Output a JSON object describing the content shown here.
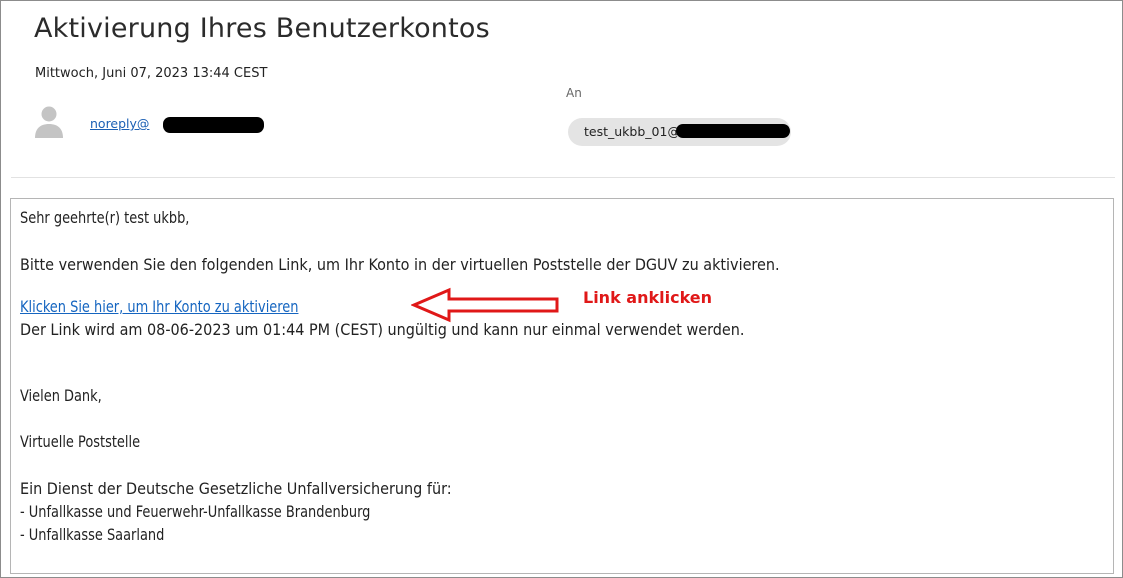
{
  "email": {
    "subject": "Aktivierung Ihres Benutzerkontos",
    "date": "Mittwoch, Juni 07, 2023 13:44 CEST",
    "sender": "noreply@",
    "to_label": "An",
    "recipient": "test_ukbb_01@"
  },
  "body": {
    "greeting": "Sehr geehrte(r) test ukbb,",
    "instruction": "Bitte verwenden Sie den folgenden Link, um Ihr Konto in der virtuellen Poststelle der DGUV zu aktivieren.",
    "link_text": "Klicken Sie hier, um Ihr Konto zu aktivieren",
    "expiry_note": "Der Link wird am 08-06-2023 um 01:44 PM (CEST) ungültig und kann nur einmal verwendet werden.",
    "thanks": "Vielen Dank,",
    "signature": "Virtuelle Poststelle",
    "service_intro": "Ein Dienst der Deutsche Gesetzliche Unfallversicherung für:",
    "service_items": [
      "- Unfallkasse und Feuerwehr-Unfallkasse Brandenburg",
      "- Unfallkasse Saarland"
    ]
  },
  "annotation": {
    "label": "Link anklicken",
    "color": "#e01818"
  },
  "icons": {
    "avatar": "user-avatar-icon",
    "arrow": "left-arrow-icon"
  }
}
